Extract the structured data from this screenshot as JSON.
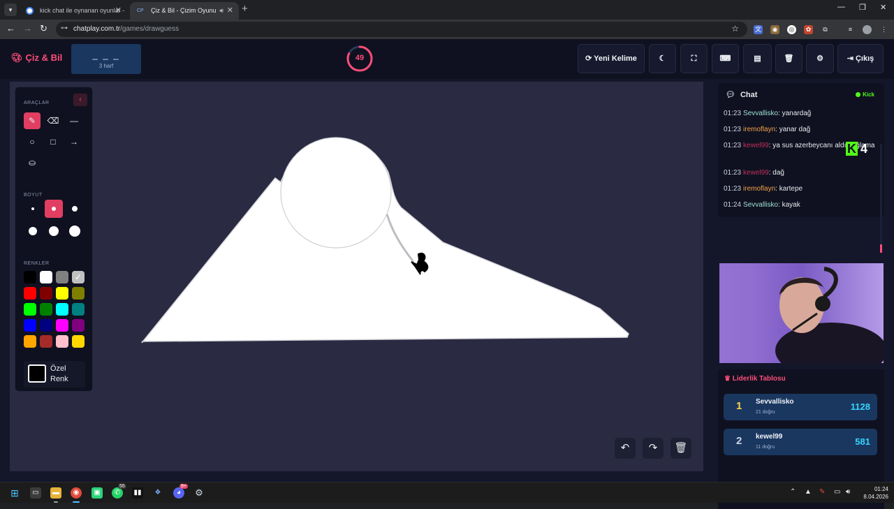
{
  "browser": {
    "tabs": [
      {
        "title": "kick chat ile oynanan oyunlar -",
        "active": false
      },
      {
        "title": "Çiz & Bil - Çizim Oyunu",
        "active": true,
        "favicon_text": "CP"
      }
    ],
    "url_host": "chatplay.com.tr",
    "url_path": "/games/drawguess"
  },
  "app": {
    "logo": "Çiz & Bil",
    "word": {
      "blanks": "_ _ _",
      "letters": "3 harf"
    },
    "timer": {
      "value": "49",
      "fraction_remaining": 0.82
    },
    "header_buttons": [
      {
        "id": "new-word",
        "label": "Yeni Kelime",
        "icon": "refresh-icon"
      },
      {
        "id": "theme",
        "label": "",
        "icon": "moon-icon"
      },
      {
        "id": "fullscreen",
        "label": "",
        "icon": "fullscreen-icon"
      },
      {
        "id": "keyboard",
        "label": "",
        "icon": "keyboard-icon"
      },
      {
        "id": "archive",
        "label": "",
        "icon": "archive-icon"
      },
      {
        "id": "trash",
        "label": "",
        "icon": "trash-icon"
      },
      {
        "id": "settings",
        "label": "",
        "icon": "gear-icon"
      },
      {
        "id": "logout",
        "label": "Çıkış",
        "icon": "sign-out-icon"
      }
    ]
  },
  "toolbox": {
    "tools_label": "ARAÇLAR",
    "size_label": "BOYUT",
    "colors_label": "RENKLER",
    "tools": [
      "brush-icon",
      "eraser-icon",
      "line-icon",
      "circle-icon",
      "square-icon",
      "arrow-icon",
      "fill-bucket-icon"
    ],
    "active_tool": "brush-icon",
    "active_size_index": 1,
    "colors": [
      "#000000",
      "#ffffff",
      "#808080",
      "#c0c0c0",
      "#ff0000",
      "#800000",
      "#ffff00",
      "#808000",
      "#00ff00",
      "#008000",
      "#00ffff",
      "#008080",
      "#0000ff",
      "#000080",
      "#ff00ff",
      "#800080",
      "#ffa500",
      "#a52a2a",
      "#ffc0cb",
      "#ffd700"
    ],
    "custom_color_label": "Özel Renk"
  },
  "canvas_controls": [
    "undo-icon",
    "redo-icon",
    "trash-icon"
  ],
  "chat": {
    "title": "Chat",
    "platform": "Kick",
    "overlay_number": "4",
    "messages": [
      {
        "time": "01:23",
        "user": "Sevvallisko",
        "color": "#9fe0d4",
        "text": ": yanardağ"
      },
      {
        "time": "01:23",
        "user": "iremoflayn",
        "color": "#f0a24a",
        "text": ": yanar dağ"
      },
      {
        "time": "01:23",
        "user": "kewel99",
        "color": "#c0305a",
        "text": ": ya sus azerbeycanı aldın ağlama"
      },
      {
        "time": "01:23",
        "user": "kewel99",
        "color": "#c0305a",
        "text": ": dağ"
      },
      {
        "time": "01:23",
        "user": "iremoflayn",
        "color": "#f0a24a",
        "text": ": kartepe"
      },
      {
        "time": "01:24",
        "user": "Sevvallisko",
        "color": "#9fe0d4",
        "text": ": kayak"
      }
    ]
  },
  "leaderboard": {
    "title": "Liderlik Tablosu",
    "rows": [
      {
        "rank": "1",
        "name": "Sevvallisko",
        "sub": "21 doğru",
        "score": "1128",
        "rank_color": "#ffd24a"
      },
      {
        "rank": "2",
        "name": "kewel99",
        "sub": "11 doğru",
        "score": "581",
        "rank_color": "#cfd6e6"
      }
    ]
  },
  "taskbar": {
    "whatsapp_badge": "55",
    "discord_badge": "9+",
    "time": "01:24",
    "date": "8.04.2026"
  }
}
